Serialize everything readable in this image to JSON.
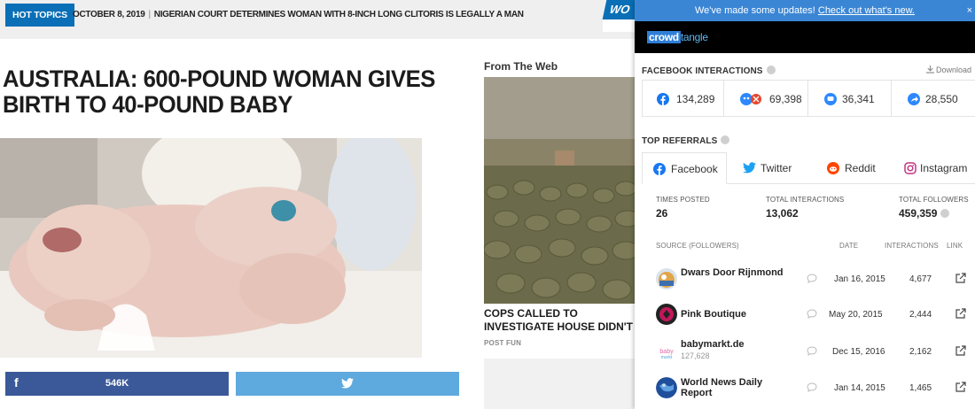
{
  "topbar": {
    "hot_topics": "HOT TOPICS",
    "date": "OCTOBER 8, 2019",
    "ticker_text": "NIGERIAN COURT DETERMINES WOMAN WITH 8-INCH LONG CLITORIS IS LEGALLY A MAN",
    "logo_partial": "WO"
  },
  "article": {
    "headline": "AUSTRALIA: 600-POUND WOMAN GIVES BIRTH TO 40-POUND BABY",
    "share_count": "546K"
  },
  "sidebar": {
    "from_web_label": "From The Web",
    "promo_title": "COPS CALLED TO INVESTIGATE HOUSE DIDN'T EXPECT TO",
    "promo_source": "POST FUN"
  },
  "crowdtangle": {
    "banner_text": "We've made some updates!",
    "banner_link": "Check out what's new.",
    "logo": {
      "part1": "crowd",
      "part2": "tangle"
    },
    "facebook_interactions": {
      "title": "FACEBOOK INTERACTIONS",
      "download_label": "Download",
      "items": [
        {
          "icon": "facebook-icon",
          "value": "134,289"
        },
        {
          "icon": "reactions-icon",
          "value": "69,398"
        },
        {
          "icon": "comment-icon",
          "value": "36,341"
        },
        {
          "icon": "share-icon",
          "value": "28,550"
        }
      ]
    },
    "top_referrals": {
      "title": "TOP REFERRALS",
      "tabs": [
        {
          "label": "Facebook",
          "active": true
        },
        {
          "label": "Twitter",
          "active": false
        },
        {
          "label": "Reddit",
          "active": false
        },
        {
          "label": "Instagram",
          "active": false
        }
      ],
      "stats": {
        "times_posted_label": "TIMES POSTED",
        "times_posted": "26",
        "total_interactions_label": "TOTAL INTERACTIONS",
        "total_interactions": "13,062",
        "total_followers_label": "TOTAL FOLLOWERS",
        "total_followers": "459,359"
      },
      "columns": [
        "SOURCE (FOLLOWERS)",
        "DATE",
        "INTERACTIONS",
        "LINK"
      ],
      "rows": [
        {
          "name": "Dwars Door Rijnmond",
          "followers": "",
          "date": "Jan 16, 2015",
          "interactions": "4,677"
        },
        {
          "name": "Pink Boutique",
          "followers": "",
          "date": "May 20, 2015",
          "interactions": "2,444"
        },
        {
          "name": "babymarkt.de",
          "followers": "127,628",
          "date": "Dec 15, 2016",
          "interactions": "2,162"
        },
        {
          "name": "World News Daily Report",
          "followers": "",
          "date": "Jan 14, 2015",
          "interactions": "1,465"
        }
      ]
    }
  },
  "colors": {
    "site_blue": "#0a6fb6",
    "facebook_blue": "#3b5998",
    "twitter_blue": "#5ea9dd",
    "ct_banner": "#3b86d4",
    "reddit_orange": "#ff4500",
    "instagram_pink": "#c13584"
  }
}
